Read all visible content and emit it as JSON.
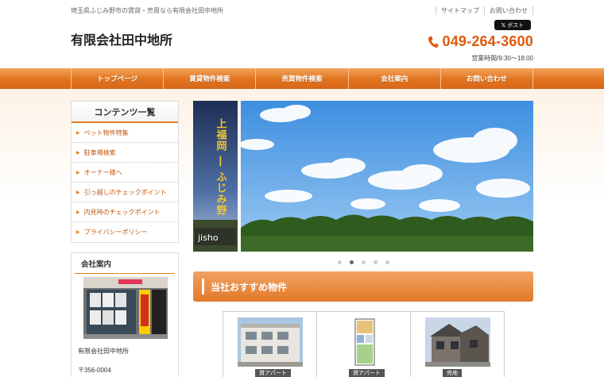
{
  "header": {
    "tagline": "埼玉県ふじみ野市の賃貸・売買なら有限会社田中地所",
    "company_title": "有限会社田中地所",
    "top_links": [
      "サイトマップ",
      "お問い合わせ"
    ],
    "post_button": "ポスト",
    "phone": "049-264-3600",
    "hours": "営業時間/9:30〜18:00"
  },
  "nav": [
    "トップページ",
    "賃貸物件検索",
    "売買物件検索",
    "会社案内",
    "お問い合わせ"
  ],
  "sidebar": {
    "title": "コンテンツ一覧",
    "items": [
      "ペット物件特集",
      "駐車場検索",
      "オーナー様へ",
      "引っ越しのチェックポイント",
      "内見時のチェックポイント",
      "プライバシーポリシー"
    ]
  },
  "company": {
    "title": "会社案内",
    "name": "有限会社田中地所",
    "zip": "〒356-0004"
  },
  "slider": {
    "side_text": "上福岡 ― ふじみ野",
    "side_sub": "jisho",
    "dot_count": 5,
    "active_dot": 1
  },
  "recommend": {
    "title": "当社おすすめ物件",
    "items": [
      {
        "label": "貸アパート"
      },
      {
        "label": "貸アパート"
      },
      {
        "label": "売地"
      }
    ]
  },
  "colors": {
    "accent": "#e3801f",
    "phone": "#e05a0c"
  }
}
